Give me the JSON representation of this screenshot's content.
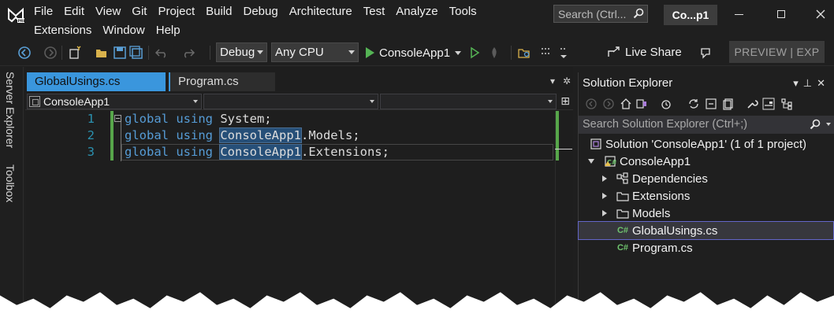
{
  "menu": {
    "row1": [
      "File",
      "Edit",
      "View",
      "Git",
      "Project",
      "Build",
      "Debug",
      "Architecture",
      "Test",
      "Analyze",
      "Tools"
    ],
    "row2": [
      "Extensions",
      "Window",
      "Help"
    ]
  },
  "search": {
    "placeholder": "Search (Ctrl..."
  },
  "title_chip": "Co...p1",
  "toolbar": {
    "config": "Debug",
    "platform": "Any CPU",
    "run_target": "ConsoleApp1",
    "live_share": "Live Share",
    "preview": "PREVIEW | EXP"
  },
  "side_tabs": [
    "Server Explorer",
    "Toolbox"
  ],
  "editor": {
    "tabs": [
      {
        "label": "GlobalUsings.cs",
        "active": true
      },
      {
        "label": "Program.cs",
        "active": false
      }
    ],
    "nav_project": "ConsoleApp1",
    "lines": [
      {
        "num": "1",
        "keyword": "global using",
        "highlight": "",
        "rest": " System;"
      },
      {
        "num": "2",
        "keyword": "global using",
        "highlight": "ConsoleApp1",
        "rest": ".Models;"
      },
      {
        "num": "3",
        "keyword": "global using",
        "highlight": "ConsoleApp1",
        "rest": ".Extensions;"
      }
    ]
  },
  "solution_explorer": {
    "title": "Solution Explorer",
    "search_placeholder": "Search Solution Explorer (Ctrl+;)",
    "tree": [
      {
        "label": "Solution 'ConsoleApp1' (1 of 1 project)",
        "icon": "solution-icon"
      },
      {
        "label": "ConsoleApp1",
        "icon": "csharp-project-icon"
      },
      {
        "label": "Dependencies",
        "icon": "dependencies-icon"
      },
      {
        "label": "Extensions",
        "icon": "folder-icon"
      },
      {
        "label": "Models",
        "icon": "folder-icon"
      },
      {
        "label": "GlobalUsings.cs",
        "icon": "csharp-file-icon",
        "selected": true
      },
      {
        "label": "Program.cs",
        "icon": "csharp-file-icon"
      }
    ]
  },
  "colors": {
    "accent": "#3a96dd",
    "keyword": "#569cd6",
    "line_number": "#2b91af",
    "change_bar": "#57a64a",
    "selection": "#264f78"
  }
}
